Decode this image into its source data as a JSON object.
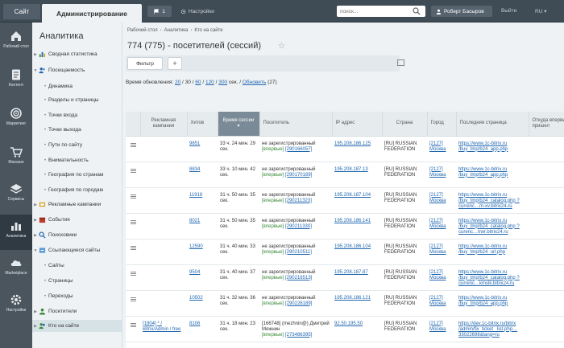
{
  "topbar": {
    "site_tab": "Сайт",
    "admin_tab": "Администрирование",
    "notif_count": "1",
    "settings_label": "Настройки",
    "search_placeholder": "поиск...",
    "user_name": "Роберт Басыров",
    "logout": "Выйти",
    "lang": "RU"
  },
  "rail": [
    {
      "label": "Рабочий стол",
      "icon": "home-icon"
    },
    {
      "label": "Контент",
      "icon": "document-icon"
    },
    {
      "label": "Маркетинг",
      "icon": "target-icon"
    },
    {
      "label": "Магазин",
      "icon": "cart-icon"
    },
    {
      "label": "Сервисы",
      "icon": "layers-icon"
    },
    {
      "label": "Аналитика",
      "icon": "chart-icon",
      "active": true
    },
    {
      "label": "Marketplace",
      "icon": "cloud-icon"
    },
    {
      "label": "Настройки",
      "icon": "gear-icon"
    }
  ],
  "menu": {
    "title": "Аналитика",
    "items": [
      {
        "label": "Сводная статистика",
        "level": 0,
        "icon": "chart-small-icon"
      },
      {
        "label": "Посещаемость",
        "level": 0,
        "icon": "users-small-icon",
        "expanded": true
      },
      {
        "label": "Динамика",
        "level": 1
      },
      {
        "label": "Разделы и страницы",
        "level": 1
      },
      {
        "label": "Точки входа",
        "level": 1
      },
      {
        "label": "Точки выхода",
        "level": 1
      },
      {
        "label": "Пути по сайту",
        "level": 1
      },
      {
        "label": "Внимательность",
        "level": 1
      },
      {
        "label": "География по странам",
        "level": 1
      },
      {
        "label": "География по городам",
        "level": 1
      },
      {
        "label": "Рекламные кампании",
        "level": 0,
        "icon": "ad-small-icon"
      },
      {
        "label": "События",
        "level": 0,
        "icon": "event-small-icon"
      },
      {
        "label": "Поисковики",
        "level": 0,
        "icon": "search-small-icon"
      },
      {
        "label": "Ссылающиеся сайты",
        "level": 0,
        "icon": "link-small-icon",
        "expanded": true
      },
      {
        "label": "Сайты",
        "level": 1
      },
      {
        "label": "Страницы",
        "level": 1
      },
      {
        "label": "Переходы",
        "level": 1
      },
      {
        "label": "Посетители",
        "level": 0,
        "icon": "visitor-small-icon"
      },
      {
        "label": "Кто на сайте",
        "level": 0,
        "icon": "online-small-icon",
        "selected": true
      }
    ]
  },
  "breadcrumbs": [
    "Рабочий стол",
    "Аналитика",
    "Кто на сайте"
  ],
  "page_title": "774 (775) - посетителей (сессий)",
  "filter_button": "Фильтр",
  "plus_button": "+",
  "refresh": {
    "label": "Время обновления:",
    "options": [
      "20",
      "30",
      "60",
      "120",
      "300"
    ],
    "suffix": "сек.",
    "refresh_link": "Обновить",
    "count": "(27)"
  },
  "table": {
    "headers": [
      "",
      "Рекламная кампания",
      "Хитов",
      "Время сессии",
      "Посетитель",
      "IP адрес",
      "Страна",
      "Город",
      "Последняя страница",
      "Откуда впервые пришел"
    ],
    "rows": [
      {
        "campaign": "",
        "hits": "9851",
        "time": "33 ч. 24 мин. 29 сек.",
        "visitor": "не зарегистрированный",
        "visitor_sub": "[впервые]",
        "visitor_id": "[290166057]",
        "ip": "195.208.186.125",
        "country": "[RU] RUSSIAN FEDERATION",
        "city": "[2127] Москва",
        "page": "https://www.1c-bitrix.ru /buy_tmp/b24_app.php",
        "from": ""
      },
      {
        "campaign": "",
        "hits": "8834",
        "time": "33 ч. 10 мин. 42 сек.",
        "visitor": "не зарегистрированный",
        "visitor_sub": "[впервые]",
        "visitor_id": "[290170189]",
        "ip": "195.208.187.13",
        "country": "[RU] RUSSIAN FEDERATION",
        "city": "[2127] Москва",
        "page": "https://www.1c-bitrix.ru /buy_tmp/b24_app.php",
        "from": ""
      },
      {
        "campaign": "",
        "hits": "11918",
        "time": "31 ч. 50 мин. 35 сек.",
        "visitor": "не зарегистрированный",
        "visitor_sub": "[впервые]",
        "visitor_id": "[290211323]",
        "ip": "195.208.187.104",
        "country": "[RU] RUSSIAN FEDERATION",
        "city": "[2127] Москва",
        "page": "https://www.1c-bitrix.ru /buy_tmp/b24_catalog.php ?currenc…m-xv.bitrix24.ru",
        "from": ""
      },
      {
        "campaign": "",
        "hits": "8021",
        "time": "31 ч. 50 мин. 35 сек.",
        "visitor": "не зарегистрированный",
        "visitor_sub": "[впервые]",
        "visitor_id": "[290211330]",
        "ip": "195.208.186.141",
        "country": "[RU] RUSSIAN FEDERATION",
        "city": "[2127] Москва",
        "page": "https://www.1c-bitrix.ru /buy_tmp/b24_catalog.php ?curenc…trwr.bitrix24.ru",
        "from": ""
      },
      {
        "campaign": "",
        "hits": "12590",
        "time": "31 ч. 40 мин. 33 сек.",
        "visitor": "не зарегистрированный",
        "visitor_sub": "[впервые]",
        "visitor_id": "[290210511]",
        "ip": "195.208.186.104",
        "country": "[RU] RUSSIAN FEDERATION",
        "city": "[2127] Москва",
        "page": "https://www.1c-bitrix.ru /buy_tmp/b24_url.php",
        "from": ""
      },
      {
        "campaign": "",
        "hits": "9504",
        "time": "31 ч. 40 мин. 37 сек.",
        "visitor": "не зарегистрированный",
        "visitor_sub": "[впервые]",
        "visitor_id": "[290218513]",
        "ip": "195.208.187.87",
        "country": "[RU] RUSSIAN FEDERATION",
        "city": "[2127] Москва",
        "page": "https://www.1c-bitrix.ru /buy_tmp/b24_catalog.php ?currenc…kmslk.bitrix24.ru",
        "from": ""
      },
      {
        "campaign": "",
        "hits": "10502",
        "time": "31 ч. 32 мин. 36 сек.",
        "visitor": "не зарегистрированный",
        "visitor_sub": "[впервые]",
        "visitor_id": "[290226189]",
        "ip": "195.208.186.121",
        "country": "[RU] RUSSIAN FEDERATION",
        "city": "[2127] Москва",
        "page": "https://www.1c-bitrix.ru /buy_tmp/b24_app.php",
        "from": ""
      },
      {
        "campaign": "[1904] * / Bitrix/Admin / free",
        "hits": "8106",
        "time": "31 ч. 18 мин. 23 сек.",
        "visitor": "[166748] (mezhnin@) Дмитрий Межнин",
        "visitor_sub": "[впервые]",
        "visitor_id": "[273486395]",
        "ip": "92.50.195.50",
        "country": "[RU] RUSSIAN FEDERATION",
        "city": "[2127] Москва",
        "page": "https://dev.1c-bitrix.ru/bitrix /admin/fix_ticket_ list.php…33022698&lang=ru",
        "from": ""
      }
    ]
  }
}
